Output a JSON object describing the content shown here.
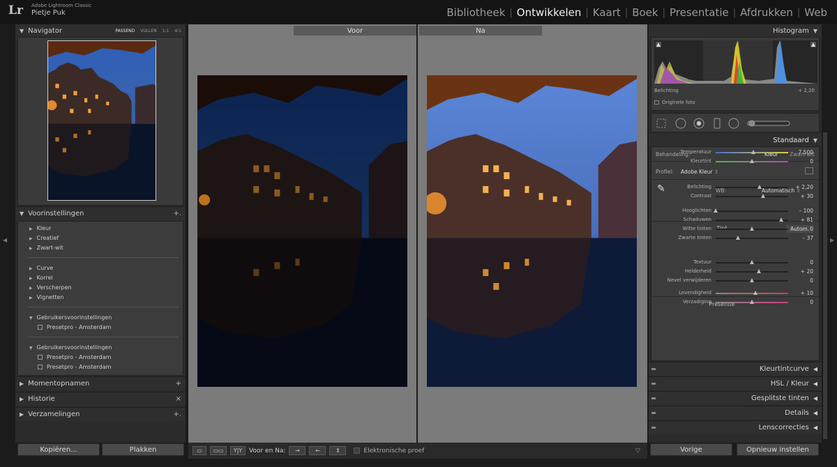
{
  "app": {
    "logo": "Lr",
    "product": "Adobe Lightroom Classic",
    "user": "Pietje Puk"
  },
  "modules": [
    {
      "label": "Bibliotheek",
      "active": false
    },
    {
      "label": "Ontwikkelen",
      "active": true
    },
    {
      "label": "Kaart",
      "active": false
    },
    {
      "label": "Boek",
      "active": false
    },
    {
      "label": "Presentatie",
      "active": false
    },
    {
      "label": "Afdrukken",
      "active": false
    },
    {
      "label": "Web",
      "active": false
    }
  ],
  "navigator": {
    "title": "Navigator",
    "modes": [
      "PASSEND",
      "VULLEN",
      "1:1",
      "4:1"
    ]
  },
  "presets": {
    "title": "Voorinstellingen",
    "items": [
      "Kleur",
      "Creatief",
      "Zwart-wit",
      "Curve",
      "Korrel",
      "Verscherpen",
      "Vignetten"
    ],
    "user_groups": [
      {
        "label": "Gebruikersvoorinstellingen",
        "children": [
          "Presetpro - Amsterdam"
        ]
      },
      {
        "label": "Gebruikersvoorinstellingen",
        "children": [
          "Presetpro - Amsterdam",
          "Presetpro - Amsterdam"
        ]
      }
    ]
  },
  "left_sections": [
    {
      "label": "Momentopnamen",
      "action": "+"
    },
    {
      "label": "Historie",
      "action": "×"
    },
    {
      "label": "Verzamelingen",
      "action": "+."
    }
  ],
  "left_buttons": {
    "copy": "Kopiëren...",
    "paste": "Plakken"
  },
  "view": {
    "before": "Voor",
    "after": "Na"
  },
  "toolbar": {
    "yy": "Y|Y",
    "before_after": "Voor en Na:",
    "soft_proof": "Elektronische proef"
  },
  "histogram": {
    "title": "Histogram",
    "label": "Belichting",
    "value": "+ 2,20",
    "original": "Originele foto"
  },
  "basic": {
    "title": "Standaard",
    "treatment_label": "Behandeling:",
    "treatment_options": [
      "Kleur",
      "Zwart-wit"
    ],
    "profile_label": "Profiel:",
    "profile_value": "Adobe Kleur",
    "wb_label": "WB:",
    "wb_value": "Automatisch",
    "tone_header": "Tint",
    "auto_label": "Autom.",
    "presence_header": "Presentie",
    "sliders": [
      {
        "label": "Temperatuur",
        "value": "7.500",
        "pos": 0.52
      },
      {
        "label": "Kleurtint",
        "value": "0",
        "pos": 0.5
      },
      {
        "label": "Belichting",
        "value": "+ 2,20",
        "pos": 0.61
      },
      {
        "label": "Contrast",
        "value": "+ 30",
        "pos": 0.65
      },
      {
        "label": "Hooglichten",
        "value": "– 100",
        "pos": 0.0
      },
      {
        "label": "Schaduwen",
        "value": "+ 81",
        "pos": 0.9
      },
      {
        "label": "Witte tinten",
        "value": "0",
        "pos": 0.5
      },
      {
        "label": "Zwarte tinten",
        "value": "– 37",
        "pos": 0.31
      },
      {
        "label": "Textuur",
        "value": "0",
        "pos": 0.5
      },
      {
        "label": "Helderheid",
        "value": "+ 20",
        "pos": 0.6
      },
      {
        "label": "Nevel verwijderen",
        "value": "0",
        "pos": 0.5
      },
      {
        "label": "Levendigheid",
        "value": "+ 10",
        "pos": 0.55
      },
      {
        "label": "Verzadiging",
        "value": "0",
        "pos": 0.5
      }
    ]
  },
  "right_sections": [
    {
      "label": "Kleurtintcurve"
    },
    {
      "label": "HSL / Kleur"
    },
    {
      "label": "Gesplitste tinten"
    },
    {
      "label": "Details"
    },
    {
      "label": "Lenscorrecties"
    }
  ],
  "right_buttons": {
    "previous": "Vorige",
    "reset": "Opnieuw instellen"
  }
}
